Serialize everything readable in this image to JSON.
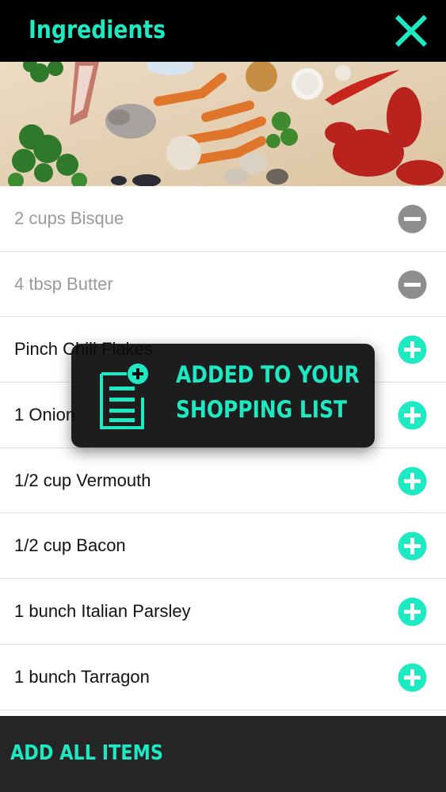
{
  "header": {
    "title": "Ingredients",
    "close_icon": "close-icon",
    "accent_color": "#1de9c3"
  },
  "hero": {
    "image": "seafood-ingredients-photo"
  },
  "ingredients": [
    {
      "label": "2 cups Bisque",
      "state": "added",
      "icon": "minus-circle-icon"
    },
    {
      "label": "4 tbsp Butter",
      "state": "added",
      "icon": "minus-circle-icon"
    },
    {
      "label": "Pinch Chili Flakes",
      "state": "not-added",
      "icon": "plus-circle-icon"
    },
    {
      "label": "1 Onion",
      "state": "not-added",
      "icon": "plus-circle-icon"
    },
    {
      "label": "1/2 cup Vermouth",
      "state": "not-added",
      "icon": "plus-circle-icon"
    },
    {
      "label": "1/2 cup Bacon",
      "state": "not-added",
      "icon": "plus-circle-icon"
    },
    {
      "label": "1 bunch Italian Parsley",
      "state": "not-added",
      "icon": "plus-circle-icon"
    },
    {
      "label": "1 bunch Tarragon",
      "state": "not-added",
      "icon": "plus-circle-icon"
    }
  ],
  "toast": {
    "line1": "ADDED TO YOUR",
    "line2": "SHOPPING LIST",
    "icon": "shopping-list-add-icon"
  },
  "footer": {
    "add_all_label": "ADD ALL ITEMS"
  }
}
